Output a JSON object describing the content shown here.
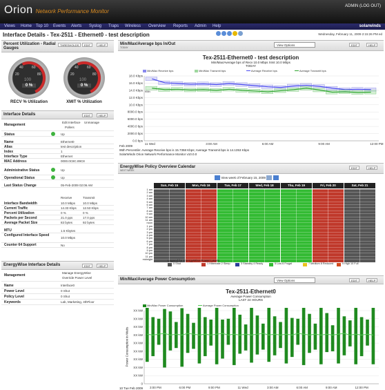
{
  "header": {
    "brand_main": "Orion",
    "brand_sub": "Network Performance Monitor",
    "admin": "ADMIN (LOG OUT)",
    "logo": "solarwinds"
  },
  "nav": [
    "Views",
    "Home",
    "Top 10",
    "Events",
    "Alerts",
    "Syslog",
    "Traps",
    "Wireless",
    "Overview",
    "Reports",
    "Admin",
    "Help"
  ],
  "page": {
    "title": "Interface Details - Tex-2511 - Ethernet0 - test description",
    "date": "Wednesday, February 11, 2009 2:15:26 PM ed"
  },
  "gauges_panel": {
    "title": "Percent Utilization - Radial Gauges",
    "buttons": [
      "THRESHOLDS",
      "EDIT",
      "HELP"
    ],
    "gauges": [
      {
        "label": "RECV % Utilization",
        "value": "0 %",
        "utilization": 0
      },
      {
        "label": "XMIT % Utilization",
        "value": "0 %",
        "utilization": 0
      }
    ],
    "ticks": [
      "20",
      "40",
      "60",
      "80",
      "100"
    ]
  },
  "interface_details": {
    "title": "Interface Details",
    "buttons": [
      "EDIT",
      "HELP"
    ],
    "management_label": "Management",
    "management_items": [
      "Edit Interface",
      "Unmanage",
      "Pollers"
    ],
    "rows": [
      {
        "label": "Status",
        "value": "Up",
        "dot": true
      },
      {
        "label": "Name",
        "value": "Ethernet0"
      },
      {
        "label": "Alias",
        "value": "test description"
      },
      {
        "label": "Index",
        "value": "1"
      },
      {
        "label": "Interface Type",
        "value": "Ethernet"
      },
      {
        "label": "MAC Address",
        "value": "0000.0C8C.89C8"
      },
      {
        "label": "Administrative Status",
        "value": "Up",
        "dot": true
      },
      {
        "label": "Operational Status",
        "value": "Up",
        "dot": true
      },
      {
        "label": "Last Status Change",
        "value": "05-Feb-2009 02:06 AM"
      }
    ],
    "traffic_header": [
      "Receive",
      "Transmit"
    ],
    "traffic_rows": [
      {
        "label": "Interface Bandwidth",
        "rx": "10.0 Mbps",
        "tx": "10.0 Mbps"
      },
      {
        "label": "Current Traffic",
        "rx": "14.33 Kbps",
        "tx": "12.53 Kbps"
      },
      {
        "label": "Percent Utilization",
        "rx": "0 %",
        "tx": "0 %"
      },
      {
        "label": "Packets per Second",
        "rx": "21.0 pps",
        "tx": "17.0 pps"
      },
      {
        "label": "Average Packet Size",
        "rx": "83 bytes",
        "tx": "92 bytes"
      }
    ],
    "misc_rows": [
      {
        "label": "MTU",
        "value": "1.5 Kbytes"
      },
      {
        "label": "Configured Interface Speed",
        "value": "10.0 Mbps"
      },
      {
        "label": "Counter 64 Support",
        "value": "No"
      }
    ]
  },
  "energywise": {
    "title": "EnergyWise Interface Details",
    "buttons": [
      "EDIT",
      "HELP"
    ],
    "management_label": "Management",
    "management_items": [
      "Manage EnergyWise",
      "Override Power Level"
    ],
    "rows": [
      {
        "label": "Name",
        "value": "Interface0"
      },
      {
        "label": "Power Level",
        "value": "0 Shut"
      },
      {
        "label": "Policy Level",
        "value": "0 Shut"
      },
      {
        "label": "Keywords",
        "value": "Lab, Marketing, 4thFloor"
      }
    ]
  },
  "bps_panel": {
    "title": "Min/Max/Average bps In/Out",
    "sub": "TODAY",
    "view_options": "View Options",
    "buttons": [
      "EDIT",
      "HELP"
    ],
    "chart_title": "Tex-2511-Ethernet0 - test description",
    "chart_sub1": "Min/Max/Average bps of    Recv 10.0 Mbps   Xmit 10.0 Mbps",
    "chart_sub2": "TODAY",
    "legend": [
      "Min/Max Receive bps",
      "Min/Max Transmit bps",
      "Average Receive bps",
      "Average Transmit bps"
    ],
    "footer1": "Feb 2009",
    "footer2": "95th Percentile: Average Receive bps is 15.7358 Kbps; Average Transmit bps is 14.1353 Kbps",
    "footer3": "SolarWinds Orion Network Performance Monitor v10.0.0",
    "ylabel_max": "95th"
  },
  "calendar_panel": {
    "title": "EnergyWise Policy Overview Calendar",
    "sub": "NEXT WEEK",
    "buttons": [
      "EDIT",
      "HELP"
    ],
    "week_label": "View week of February 15, 2009",
    "days": [
      "Sun, Feb 15",
      "Mon, Feb 16",
      "Tue, Feb 17",
      "Wed, Feb 18",
      "Thu, Feb 19",
      "Fri, Feb 20",
      "Sat, Feb 21"
    ],
    "hours": [
      "1 am",
      "2 am",
      "3 am",
      "4 am",
      "5 am",
      "6 am",
      "7 am",
      "8 am",
      "9 am",
      "10 am",
      "11 am",
      "noon",
      "1 pm",
      "2 pm",
      "3 pm",
      "4 pm",
      "5 pm",
      "6 pm",
      "7 pm",
      "8 pm",
      "9 pm",
      "10 pm",
      "11 pm",
      "midnight"
    ],
    "legend_title": "Legend for EnergyWise Power Levels",
    "legend": [
      {
        "label": "0 Shut",
        "color": "#555555"
      },
      {
        "label": "1 Hibernate 2 Sleep",
        "color": "#c0392b"
      },
      {
        "label": "3 Standby 4 Ready",
        "color": "#2c3e9a"
      },
      {
        "label": "5 Low 6 Frugal",
        "color": "#33bb33"
      },
      {
        "label": "7 Medium 8 Reduced",
        "color": "#e8c31e"
      },
      {
        "label": "9 High 10 Full",
        "color": "#d24a1d"
      }
    ]
  },
  "power_panel": {
    "title": "Min/Max/Average Power Consumption",
    "view_options": "View Options",
    "buttons": [
      "EDIT",
      "HELP"
    ],
    "chart_title": "Tex-2511-Ethernet0",
    "chart_sub1": "Average Power Consumption",
    "chart_sub2": "LAST 24 HOURS",
    "legend": [
      "Min/Max Power Consumption",
      "Average Power Consumption"
    ],
    "ylabel": "Power Consumption in Watts",
    "footer": "10 Tue Feb 2009"
  },
  "chart_data": [
    {
      "type": "line",
      "title": "Tex-2511-Ethernet0 - test description",
      "xlabel": "",
      "ylabel": "",
      "x": [
        "11 Wed",
        "3:00 AM",
        "6:00 AM",
        "9:00 AM",
        "12:00 PM"
      ],
      "y_ticks": [
        "0.0 bps",
        "2000.0 bps",
        "4000.0 bps",
        "6000.0 bps",
        "8000.0 bps",
        "10.0 Kbps",
        "12.0 Kbps",
        "14.0 Kbps",
        "16.0 Kbps",
        "18.0 Kbps"
      ],
      "ylim": [
        0,
        18
      ],
      "series": [
        {
          "name": "Average Receive bps",
          "color": "#4a4af0",
          "values": [
            17.2,
            16.1,
            15.9,
            15.7,
            15.8,
            15.6,
            15.9,
            15.6,
            15.3,
            15.0,
            14.8,
            15.2,
            15.4,
            15.1,
            14.6,
            14.2,
            14.3,
            14.2
          ]
        },
        {
          "name": "Average Transmit bps",
          "color": "#2fa52f",
          "values": [
            14.6,
            14.2,
            14.3,
            14.1,
            14.2,
            14.0,
            14.3,
            14.0,
            13.8,
            13.6,
            13.9,
            14.2,
            14.6,
            14.1,
            13.5,
            13.6,
            13.4,
            13.5
          ]
        }
      ]
    },
    {
      "type": "bar",
      "title": "Tex-2511-Ethernet0",
      "xlabel": "",
      "ylabel": "Power Consumption in Watts",
      "x": [
        "3:00 PM",
        "6:00 PM",
        "9:00 PM",
        "11 Wed",
        "3:00 AM",
        "6:00 AM",
        "9:00 AM",
        "12:00 PM"
      ],
      "y_ticks": [
        "0",
        "XX kW",
        "XX kW",
        "XX kW",
        "XX kW",
        "XX kW",
        "XX kW",
        "XX kW",
        "XX kW",
        "XX kW"
      ],
      "ylim": [
        0,
        9
      ],
      "series": [
        {
          "name": "Min/Max Power Consumption",
          "color": "#1f8a1f",
          "values": [
            6.3,
            5.8,
            6.4,
            5.6,
            6.5,
            6.0,
            5.7,
            6.2,
            5.9,
            6.1,
            5.8,
            6.3,
            6.0,
            5.5,
            6.4,
            5.9,
            6.1,
            5.7,
            6.2,
            6.0,
            5.8,
            6.3,
            5.9,
            6.0,
            6.1,
            5.7,
            6.4,
            5.9,
            6.2,
            5.8,
            6.0,
            6.3,
            5.6,
            6.1,
            5.9,
            6.2,
            6.0,
            5.8,
            6.3,
            6.0
          ]
        },
        {
          "name": "Average Power Consumption",
          "color": "#57c957",
          "values": [
            6.1,
            6.0,
            6.1,
            6.2,
            6.0,
            6.1,
            6.0,
            6.2,
            6.1,
            6.0,
            6.1,
            6.0,
            6.1,
            6.2,
            6.0,
            6.1,
            6.0,
            6.1,
            6.0,
            6.1,
            6.2,
            6.0,
            6.1,
            6.0,
            6.1,
            6.0,
            6.2,
            6.1,
            6.0,
            6.1,
            6.0,
            6.1,
            6.0,
            6.1,
            6.2,
            6.0,
            6.1,
            6.0,
            6.1,
            6.0
          ]
        }
      ]
    }
  ]
}
